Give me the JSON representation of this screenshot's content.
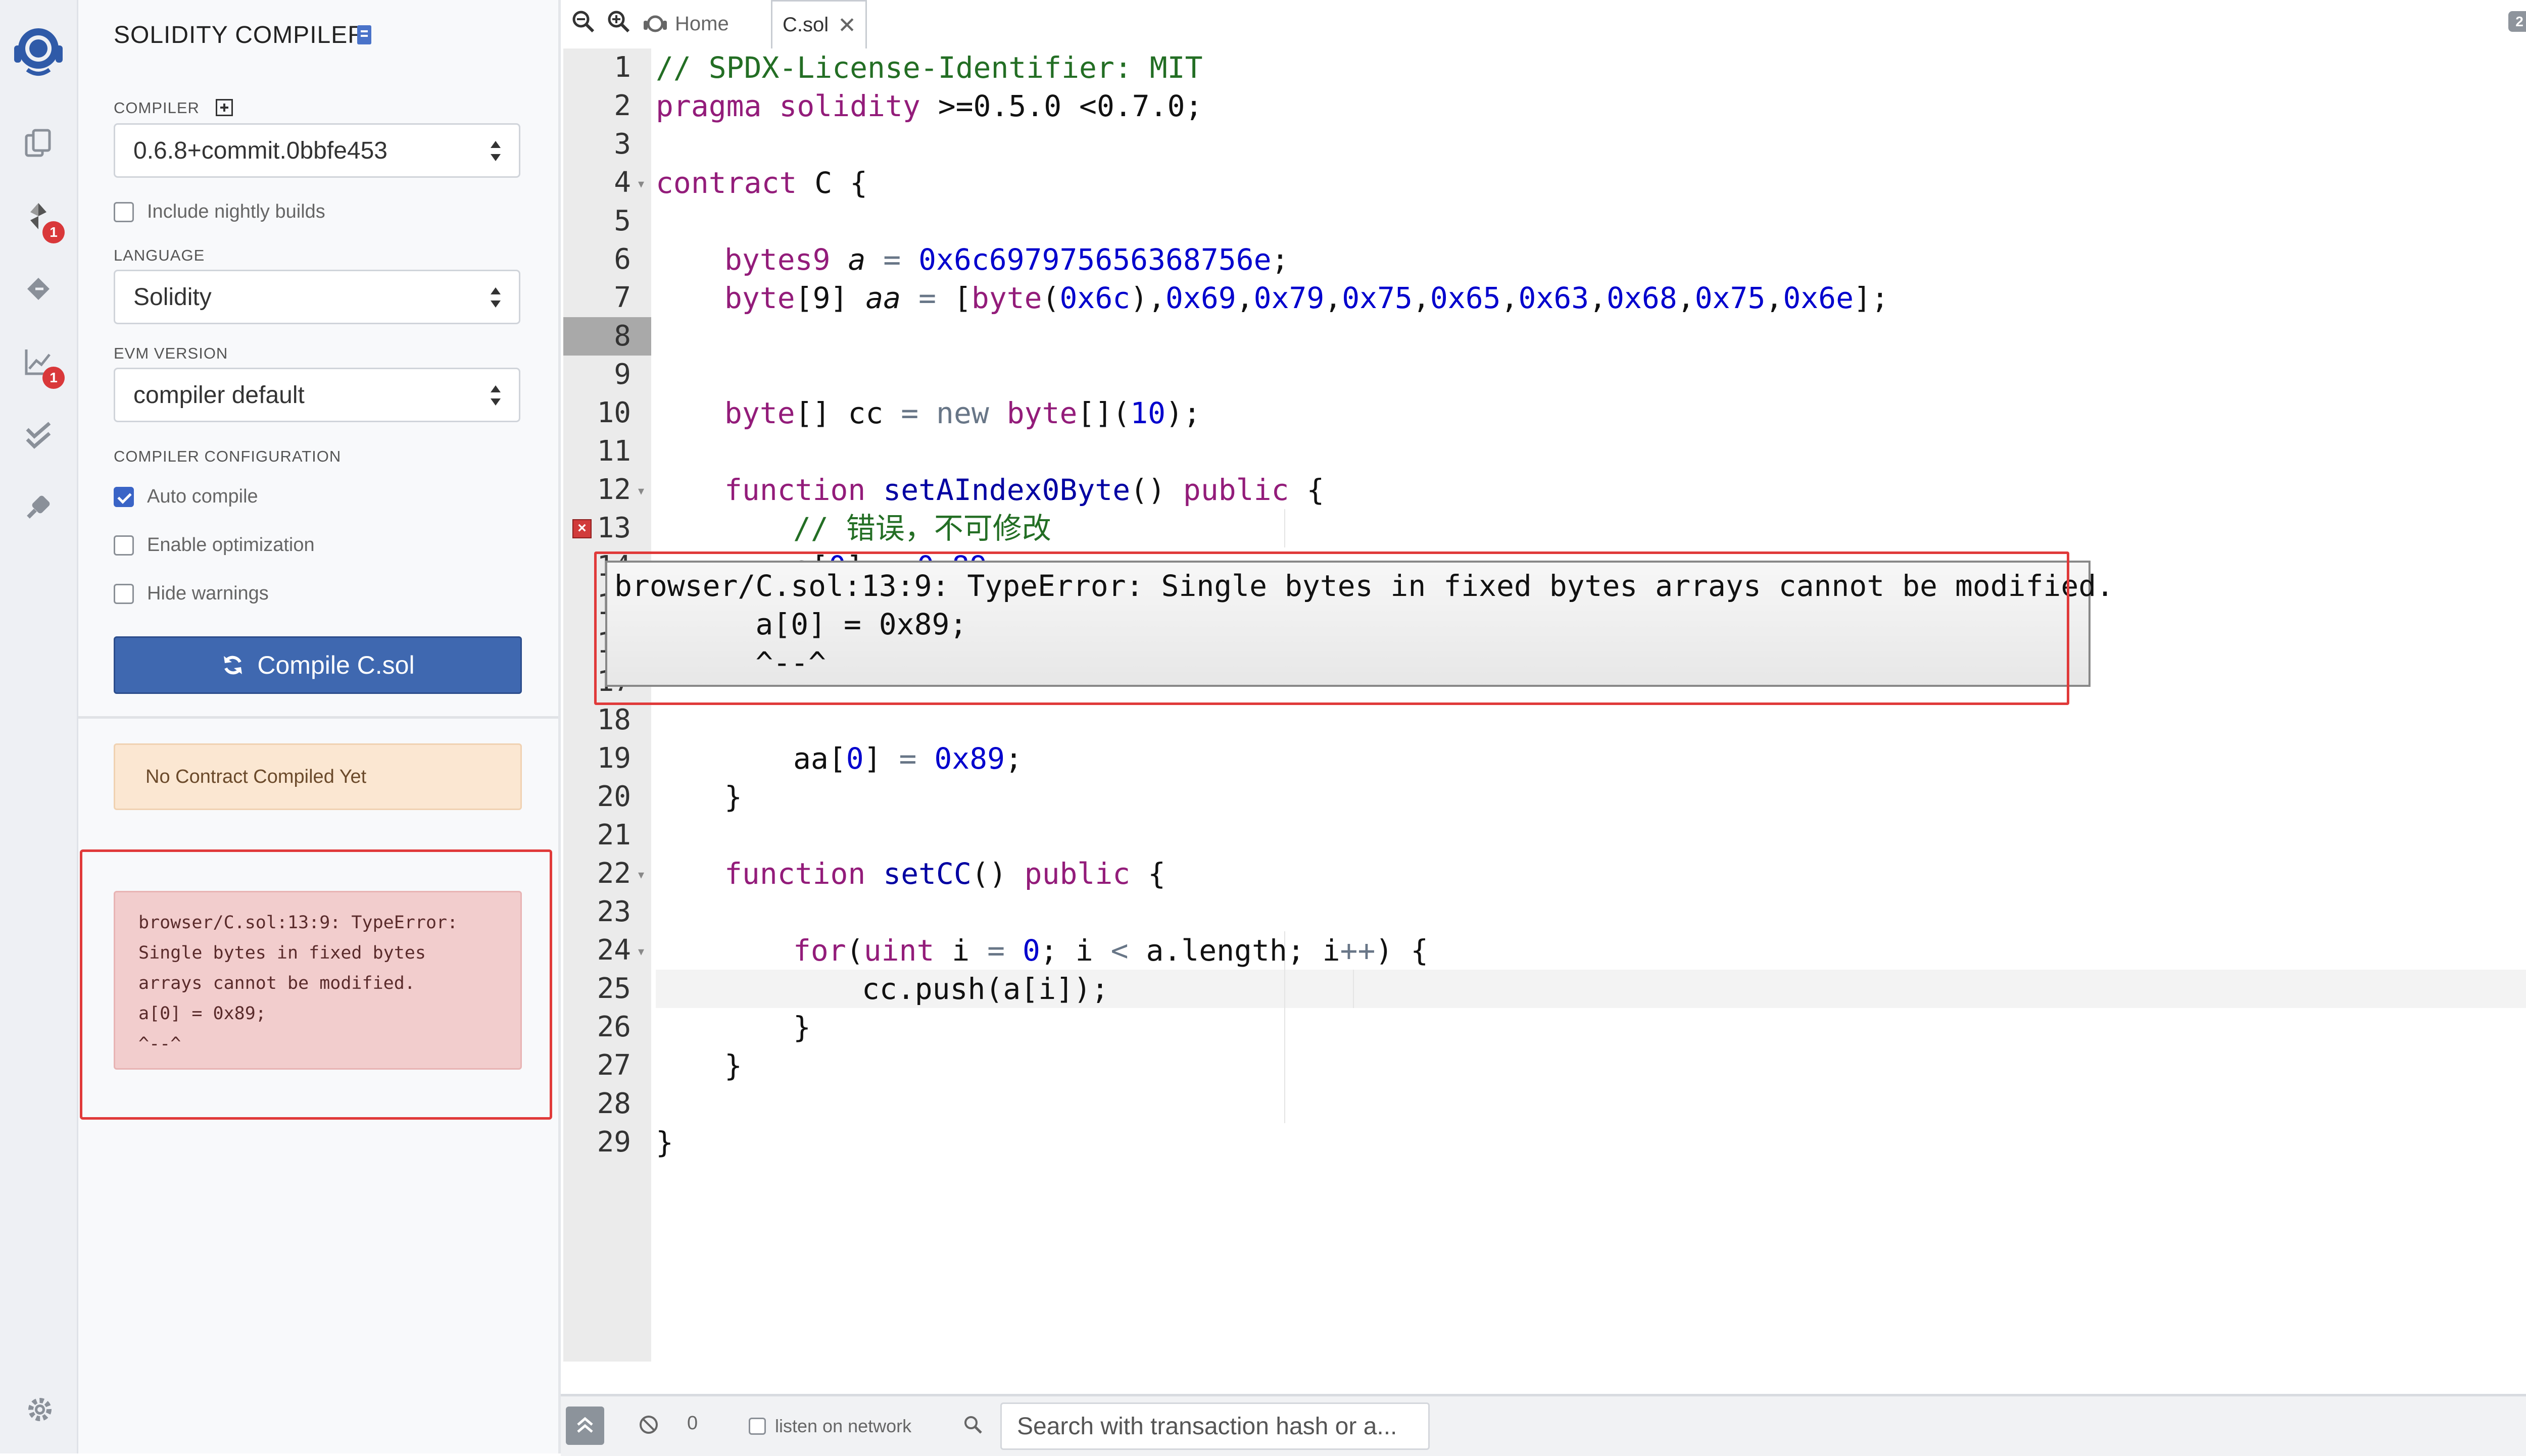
{
  "panel": {
    "title": "SOLIDITY COMPILER",
    "compiler_label": "COMPILER",
    "compiler_version": "0.6.8+commit.0bbfe453",
    "nightly_label": "Include nightly builds",
    "language_label": "LANGUAGE",
    "language_value": "Solidity",
    "evm_label": "EVM VERSION",
    "evm_value": "compiler default",
    "config_label": "COMPILER CONFIGURATION",
    "auto_compile": "Auto compile",
    "enable_optimization": "Enable optimization",
    "hide_warnings": "Hide warnings",
    "compile_button": "Compile C.sol",
    "no_contract": "No Contract Compiled Yet",
    "error_text": "browser/C.sol:13:9: TypeError:\nSingle bytes in fixed bytes\narrays cannot be modified.\na[0] = 0x89;\n^--^"
  },
  "rail": {
    "badge_compiler": "1",
    "badge_analysis": "1"
  },
  "tabs": {
    "home": "Home",
    "file": "C.sol",
    "count": "2 tabs"
  },
  "editor": {
    "line_numbers": [
      "1",
      "2",
      "3",
      "4",
      "5",
      "6",
      "7",
      "8",
      "9",
      "10",
      "11",
      "12",
      "13",
      "14",
      "15",
      "16",
      "17",
      "18",
      "19",
      "20",
      "21",
      "22",
      "23",
      "24",
      "25",
      "26",
      "27",
      "28",
      "29"
    ],
    "l1": "// SPDX-License-Identifier: MIT",
    "l2_a": "pragma solidity ",
    "l2_b": ">=0.5.0 <0.7.0;",
    "l4_a": "contract ",
    "l4_b": "C {",
    "l6_a": "bytes9 ",
    "l6_b": "a ",
    "l6_c": "= ",
    "l6_d": "0x6c697975656368756e",
    "l6_e": ";",
    "l7_a": "byte",
    "l7_b": "[9] ",
    "l7_c": "aa ",
    "l7_d": "= ",
    "l7_e": "[",
    "l7_f": "byte",
    "l7_g": "(",
    "l7_h": "0x6c",
    "l7_i": "),",
    "l7_j": "0x69",
    "l7_k": ",",
    "l7_l": "0x79",
    "l7_m": ",",
    "l7_n": "0x75",
    "l7_o": ",",
    "l7_p": "0x65",
    "l7_q": ",",
    "l7_r": "0x63",
    "l7_s": ",",
    "l7_t": "0x68",
    "l7_u": ",",
    "l7_v": "0x75",
    "l7_w": ",",
    "l7_x": "0x6e",
    "l7_y": "];",
    "l9_a": "byte",
    "l9_b": "[] cc ",
    "l9_c": "= ",
    "l9_d": "new ",
    "l9_e": "byte",
    "l9_f": "[](",
    "l9_g": "10",
    "l9_h": ");",
    "l11_a": "function ",
    "l11_b": "setAIndex0Byte",
    "l11_c": "() ",
    "l11_d": "public ",
    "l11_e": "{",
    "l12": "// 错误，不可修改",
    "l13_a": "a[",
    "l13_b": "0",
    "l13_c": "] ",
    "l13_d": "= ",
    "l13_e": "0x89",
    "l13_f": ";",
    "l18_a": "aa[",
    "l18_b": "0",
    "l18_c": "] ",
    "l18_d": "= ",
    "l18_e": "0x89",
    "l18_f": ";",
    "l19": "}",
    "l21_a": "function ",
    "l21_b": "setCC",
    "l21_c": "() ",
    "l21_d": "public ",
    "l21_e": "{",
    "l23_a": "for",
    "l23_b": "(",
    "l23_c": "uint ",
    "l23_d": "i ",
    "l23_e": "= ",
    "l23_f": "0",
    "l23_g": "; i ",
    "l23_h": "< ",
    "l23_i": "a.length; i",
    "l23_j": "++",
    "l23_k": ") {",
    "l25": "cc.push(a[i]);",
    "l26": "}",
    "l27": "}",
    "l29": "}",
    "tooltip": "browser/C.sol:13:9: TypeError: Single bytes in fixed bytes arrays cannot be modified.\n        a[0] = 0x89;\n        ^--^",
    "status_char": "C"
  },
  "terminal": {
    "count": "0",
    "listen_label": "listen on network",
    "search_placeholder": "Search with transaction hash or a..."
  },
  "colors": {
    "accent": "#3f68b0",
    "error": "#e03a3a",
    "comment": "#236e24",
    "keyword": "#931c7a",
    "number": "#0000cd"
  }
}
